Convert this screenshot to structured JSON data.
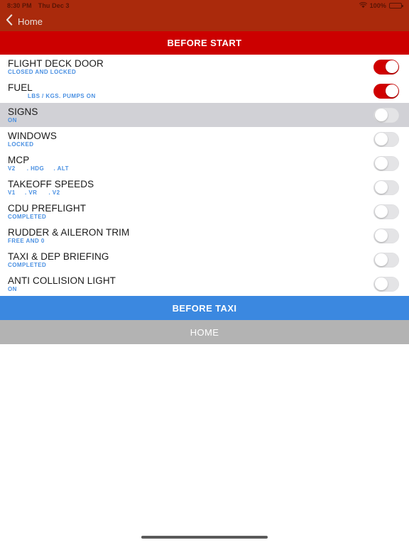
{
  "statusbar": {
    "time": "8:30 PM",
    "date": "Thu Dec 3",
    "battery_percent": "100%",
    "wifi_icon": "wifi-icon",
    "battery_icon": "battery-full-icon"
  },
  "navbar": {
    "back_label": "Home",
    "back_icon": "chevron-left-icon"
  },
  "section": {
    "title": "BEFORE START"
  },
  "checklist": {
    "items": [
      {
        "title": "FLIGHT DECK DOOR",
        "subtitle": "CLOSED AND LOCKED",
        "state": "on",
        "indent": false,
        "selected": false
      },
      {
        "title": "FUEL",
        "subtitle": "LBS / KGS. PUMPS ON",
        "state": "on",
        "indent": true,
        "selected": false
      },
      {
        "title": "SIGNS",
        "subtitle": "ON",
        "state": "off",
        "indent": false,
        "selected": true
      },
      {
        "title": "WINDOWS",
        "subtitle": "LOCKED",
        "state": "off",
        "indent": false,
        "selected": false
      },
      {
        "title": "MCP",
        "subtitle": "V2      . HDG     . ALT",
        "state": "off",
        "indent": false,
        "selected": false
      },
      {
        "title": "TAKEOFF SPEEDS",
        "subtitle": "V1     . VR      . V2",
        "state": "off",
        "indent": false,
        "selected": false
      },
      {
        "title": "CDU PREFLIGHT",
        "subtitle": "COMPLETED",
        "state": "off",
        "indent": false,
        "selected": false
      },
      {
        "title": "RUDDER & AILERON TRIM",
        "subtitle": "FREE AND 0",
        "state": "off",
        "indent": false,
        "selected": false
      },
      {
        "title": "TAXI & DEP BRIEFING",
        "subtitle": "COMPLETED",
        "state": "off",
        "indent": false,
        "selected": false
      },
      {
        "title": "ANTI COLLISION LIGHT",
        "subtitle": "ON",
        "state": "off",
        "indent": false,
        "selected": false
      }
    ]
  },
  "footer": {
    "next_label": "BEFORE TAXI",
    "home_label": "HOME"
  },
  "colors": {
    "nav_red": "#AA2A0C",
    "header_red": "#CC0000",
    "toggle_on": "#D00000",
    "subtitle_blue": "#4A90E2",
    "next_blue": "#3B88E0",
    "home_gray": "#B3B3B3",
    "row_selected": "#D1D1D6"
  }
}
